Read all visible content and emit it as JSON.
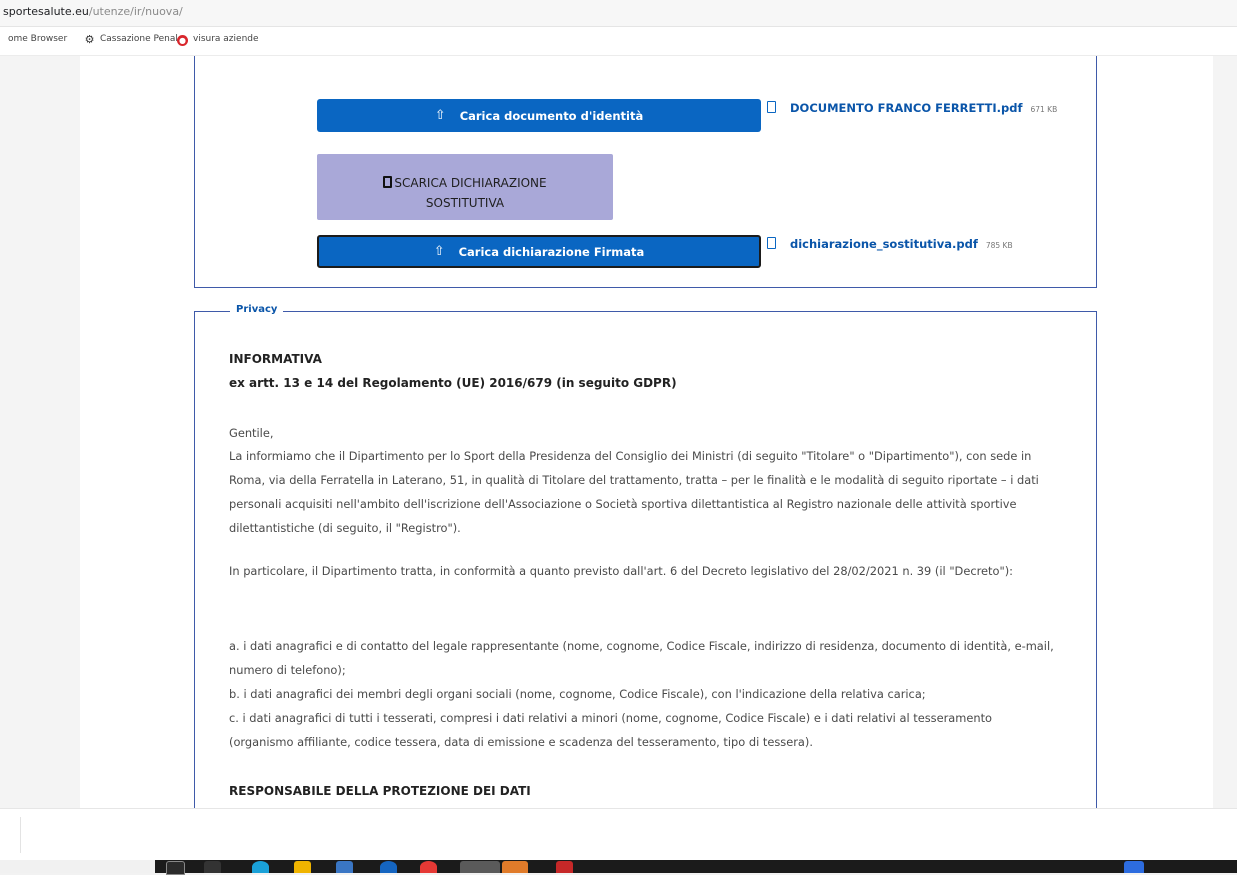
{
  "browser": {
    "url_host": "sportesalute.eu",
    "url_path": "/utenze/ir/nuova/",
    "bookmarks": [
      {
        "label": "ome Browser",
        "icon": "page-icon"
      },
      {
        "label": "Cassazione Penale",
        "icon": "cassazione-icon"
      },
      {
        "label": "visura aziende",
        "icon": "visura-icon"
      }
    ]
  },
  "documents": {
    "upload_identity_label": "Carica documento d'identità",
    "identity_file_name": "DOCUMENTO FRANCO FERRETTI.pdf",
    "identity_file_size": "671 KB",
    "download_label_line1": "SCARICA DICHIARAZIONE",
    "download_label_line2": "SOSTITUTIVA",
    "upload_signed_label": "Carica dichiarazione Firmata",
    "signed_file_name": "dichiarazione_sostitutiva.pdf",
    "signed_file_size": "785 KB",
    "upload_icon": "upload-icon",
    "file_icon": "file-icon"
  },
  "privacy": {
    "legend": "Privacy",
    "title": "INFORMATIVA",
    "subtitle": "ex artt. 13 e 14 del Regolamento (UE) 2016/679 (in seguito GDPR)",
    "greeting": "Gentile,",
    "para1": "La informiamo che il Dipartimento per lo Sport della Presidenza del Consiglio dei Ministri (di seguito \"Titolare\" o \"Dipartimento\"), con sede in Roma, via della Ferratella in Laterano, 51, in qualità di Titolare del trattamento, tratta – per le finalità e le modalità di seguito riportate – i dati personali acquisiti nell'ambito dell'iscrizione dell'Associazione o Società sportiva dilettantistica al Registro nazionale delle attività sportive dilettantistiche (di seguito, il \"Registro\").",
    "para2": "In particolare, il Dipartimento tratta, in conformità a quanto previsto dall'art. 6 del Decreto legislativo del 28/02/2021 n. 39 (il \"Decreto\"):",
    "item_a": "a. i dati anagrafici e di contatto del legale rappresentante (nome, cognome, Codice Fiscale, indirizzo di residenza, documento di identità, e-mail, numero di telefono);",
    "item_b": "b. i dati anagrafici dei membri degli organi sociali (nome, cognome, Codice Fiscale), con l'indicazione della relativa carica;",
    "item_c": "c. i dati anagrafici di tutti i tesserati, compresi i dati relativi a minori (nome, cognome, Codice Fiscale) e i dati relativi al tesseramento (organismo affiliante, codice tessera, data di emissione e scadenza del tesseramento, tipo di tessera).",
    "section_heading": "RESPONSABILE DELLA PROTEZIONE DEI DATI"
  },
  "colors": {
    "primary_button": "#0a66c2",
    "download_button": "#a9a8d8",
    "border": "#3f5aa9"
  }
}
